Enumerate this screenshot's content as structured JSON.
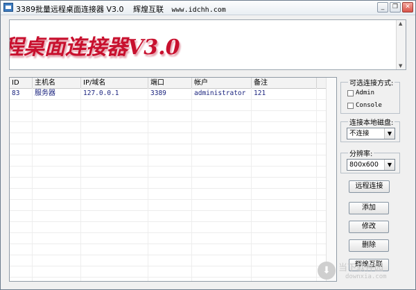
{
  "window": {
    "title": "3389批量远程桌面连接器 V3.0",
    "site": "www.idchh.com",
    "brand": "辉煌互联",
    "buttons": {
      "min": "_",
      "restore": "❐",
      "close": "✕"
    }
  },
  "banner": {
    "text": "程桌面连接器V3.0"
  },
  "table": {
    "columns": [
      "ID",
      "主机名",
      "IP/域名",
      "端口",
      "帐户",
      "备注"
    ],
    "rows": [
      [
        "83",
        "服务器",
        "127.0.0.1",
        "3389",
        "administrator",
        "121"
      ]
    ]
  },
  "panel": {
    "connect_mode": {
      "title": "可选连接方式:",
      "options": [
        "Admin",
        "Console"
      ]
    },
    "local_disk": {
      "title": "连接本地磁盘:",
      "selected": "不连接"
    },
    "resolution": {
      "title": "分辨率:",
      "selected": "800x600"
    },
    "buttons": {
      "remote_connect": "远程连接",
      "add": "添加",
      "edit": "修改",
      "delete": "删除",
      "brand": "辉煌互联"
    }
  },
  "watermark": {
    "text": "当下软件园",
    "sub": "downxia.com"
  }
}
